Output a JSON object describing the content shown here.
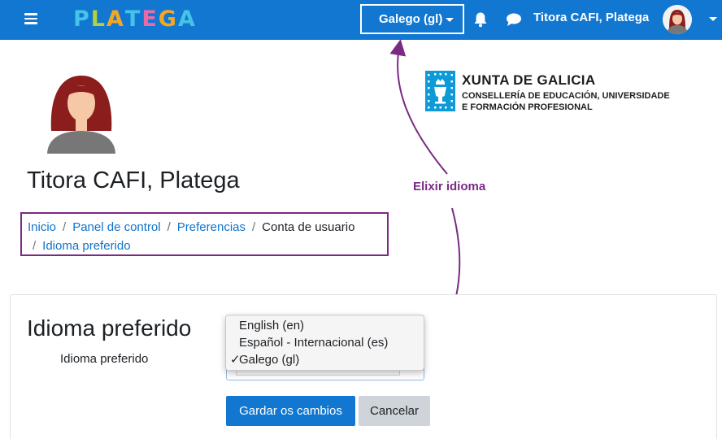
{
  "navbar": {
    "logo_letters": [
      "P",
      "L",
      "A",
      "T",
      "E",
      "G",
      "A"
    ],
    "logo_colors": [
      "#46c3e6",
      "#b2d235",
      "#f5a623",
      "#46c3e6",
      "#e96aa7",
      "#f5a623",
      "#46c3e6"
    ],
    "language_button": "Galego (gl)",
    "user_name": "Titora CAFI, Platega",
    "background_color": "#1177d1"
  },
  "profile": {
    "name": "Titora CAFI, Platega"
  },
  "xunta": {
    "title": "XUNTA DE GALICIA",
    "subtitle_line1": "CONSELLERÍA DE EDUCACIÓN, UNIVERSIDADE",
    "subtitle_line2": "E FORMACIÓN PROFESIONAL"
  },
  "breadcrumb": {
    "items": [
      "Inicio",
      "Panel de control",
      "Preferencias",
      "Conta de usuario",
      "Idioma preferido"
    ],
    "separator": "/"
  },
  "annotation": {
    "label": "Elixir idioma",
    "color": "#7a2a84"
  },
  "form": {
    "heading": "Idioma preferido",
    "field_label": "Idioma preferido",
    "options": [
      "English (en)",
      "Español - Internacional (es)",
      "Galego (gl)"
    ],
    "selected_option": "Galego (gl)",
    "check_mark": "✓",
    "save_label": "Gardar os cambios",
    "cancel_label": "Cancelar"
  }
}
